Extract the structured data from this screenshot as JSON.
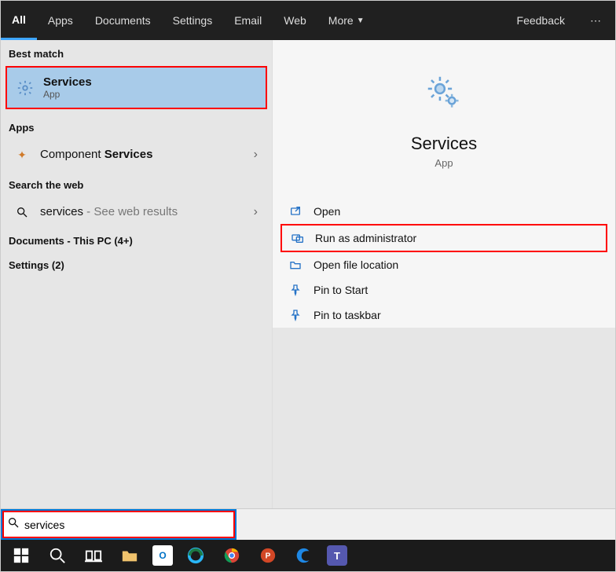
{
  "tabs": {
    "all": "All",
    "apps": "Apps",
    "documents": "Documents",
    "settings": "Settings",
    "email": "Email",
    "web": "Web",
    "more": "More",
    "feedback": "Feedback"
  },
  "left": {
    "bestmatch_label": "Best match",
    "bestmatch": {
      "title": "Services",
      "sub": "App"
    },
    "apps_label": "Apps",
    "apps_item": {
      "prefix": "Component ",
      "bold": "Services"
    },
    "search_web_label": "Search the web",
    "web_item": {
      "term": "services",
      "suffix": " - See web results"
    },
    "documents_line": "Documents - This PC (4+)",
    "settings_line": "Settings (2)"
  },
  "detail": {
    "title": "Services",
    "sub": "App",
    "actions": {
      "open": "Open",
      "run_admin": "Run as administrator",
      "open_location": "Open file location",
      "pin_start": "Pin to Start",
      "pin_taskbar": "Pin to taskbar"
    }
  },
  "search": {
    "value": "services"
  }
}
